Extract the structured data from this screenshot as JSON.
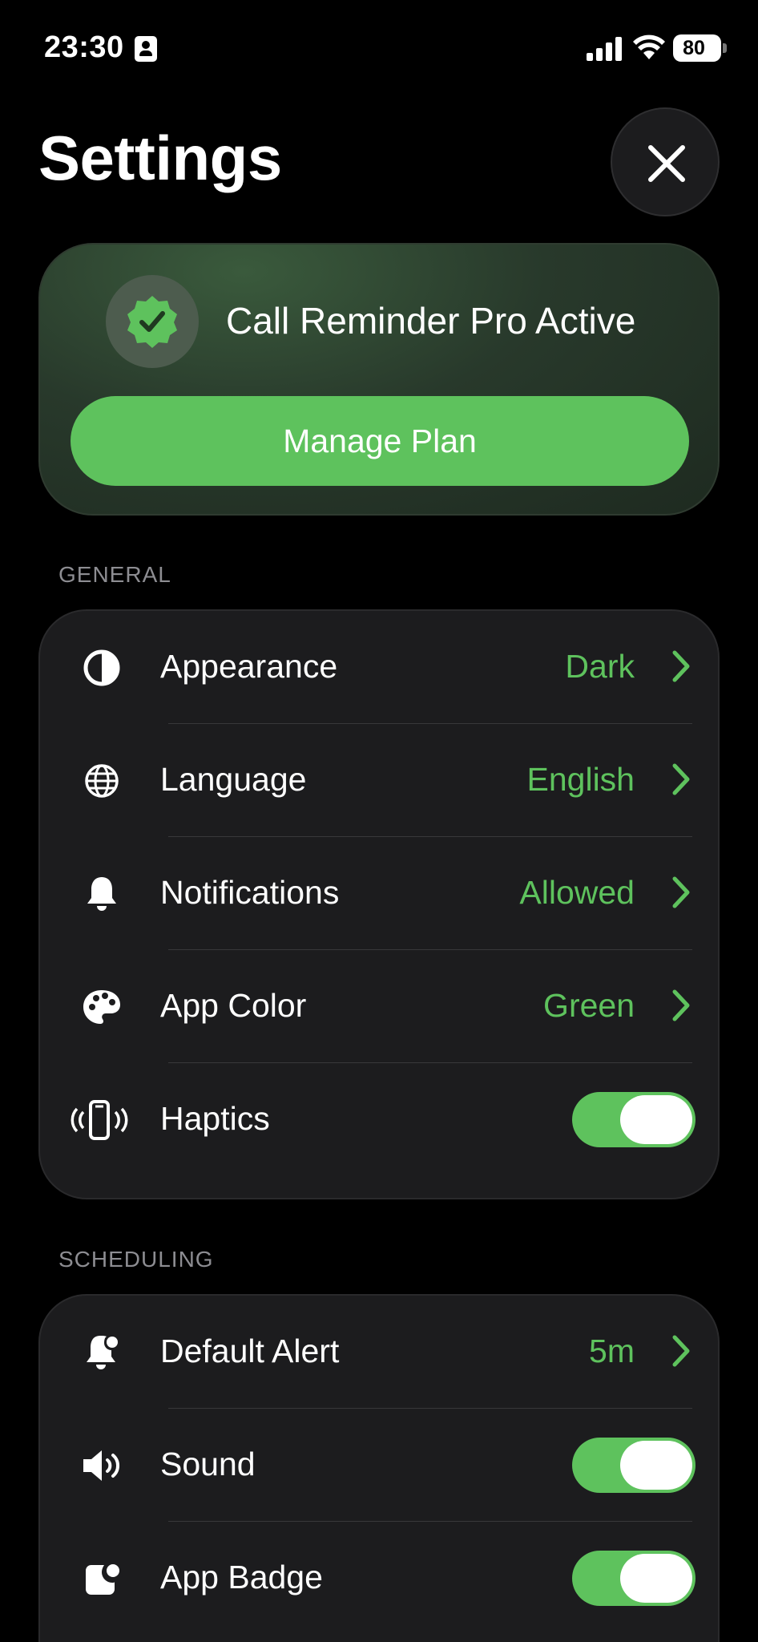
{
  "status_bar": {
    "time": "23:30",
    "battery": "80"
  },
  "header": {
    "title": "Settings"
  },
  "pro_card": {
    "title": "Call Reminder Pro Active",
    "manage_label": "Manage Plan"
  },
  "general": {
    "header": "GENERAL",
    "rows": [
      {
        "label": "Appearance",
        "value": "Dark",
        "icon": "contrast-icon"
      },
      {
        "label": "Language",
        "value": "English",
        "icon": "globe-icon"
      },
      {
        "label": "Notifications",
        "value": "Allowed",
        "icon": "bell-icon"
      },
      {
        "label": "App Color",
        "value": "Green",
        "icon": "palette-icon"
      },
      {
        "label": "Haptics",
        "toggle": true,
        "icon": "phone-vibrate-icon"
      }
    ]
  },
  "scheduling": {
    "header": "SCHEDULING",
    "rows": [
      {
        "label": "Default Alert",
        "value": "5m",
        "icon": "bell-badge-icon"
      },
      {
        "label": "Sound",
        "toggle": true,
        "icon": "speaker-icon"
      },
      {
        "label": "App Badge",
        "toggle": true,
        "icon": "app-badge-icon"
      }
    ]
  },
  "colors": {
    "accent": "#5ec25d",
    "card": "#1c1c1e",
    "background": "#000000"
  }
}
